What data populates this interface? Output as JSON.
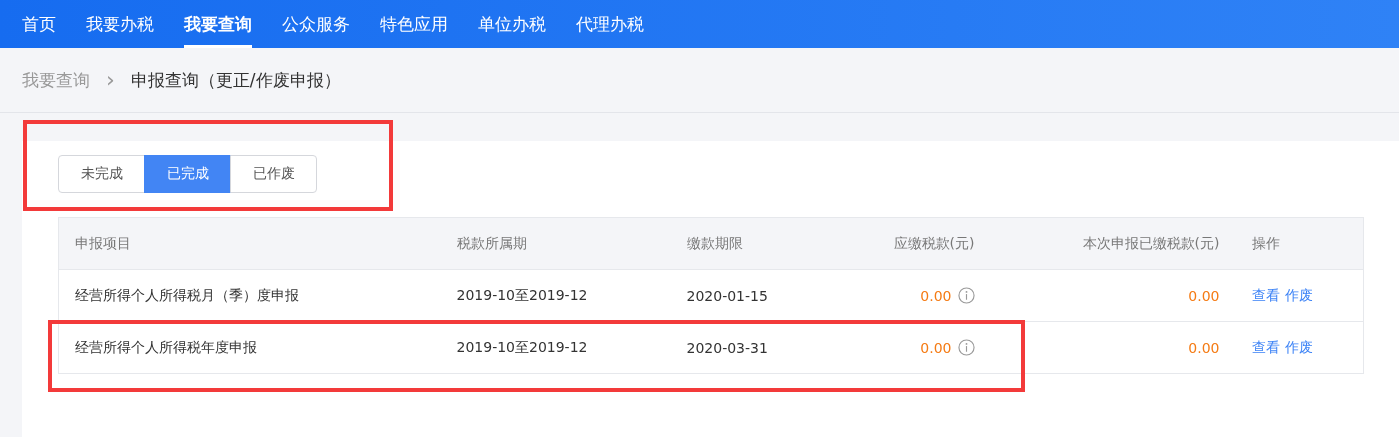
{
  "nav": {
    "items": [
      {
        "label": "首页",
        "selected": false
      },
      {
        "label": "我要办税",
        "selected": false
      },
      {
        "label": "我要查询",
        "selected": true
      },
      {
        "label": "公众服务",
        "selected": false
      },
      {
        "label": "特色应用",
        "selected": false
      },
      {
        "label": "单位办税",
        "selected": false
      },
      {
        "label": "代理办税",
        "selected": false
      }
    ]
  },
  "breadcrumb": {
    "parent": "我要查询",
    "separator": "›",
    "current": "申报查询（更正/作废申报）"
  },
  "status_tabs": {
    "highlighted": true,
    "items": [
      {
        "label": "未完成",
        "selected": false
      },
      {
        "label": "已完成",
        "selected": true
      },
      {
        "label": "已作废",
        "selected": false
      }
    ]
  },
  "table": {
    "columns": [
      "申报项目",
      "税款所属期",
      "缴款期限",
      "应缴税款(元)",
      "本次申报已缴税款(元)",
      "操作"
    ],
    "rows": [
      {
        "item": "经营所得个人所得税月（季）度申报",
        "period": "2019-10至2019-12",
        "deadline": "2020-01-15",
        "tax_due": "0.00",
        "tax_paid": "0.00",
        "actions": [
          "查看",
          "作废"
        ],
        "highlighted": false
      },
      {
        "item": "经营所得个人所得税年度申报",
        "period": "2019-10至2019-12",
        "deadline": "2020-03-31",
        "tax_due": "0.00",
        "tax_paid": "0.00",
        "actions": [
          "查看",
          "作废"
        ],
        "highlighted": true
      }
    ]
  }
}
